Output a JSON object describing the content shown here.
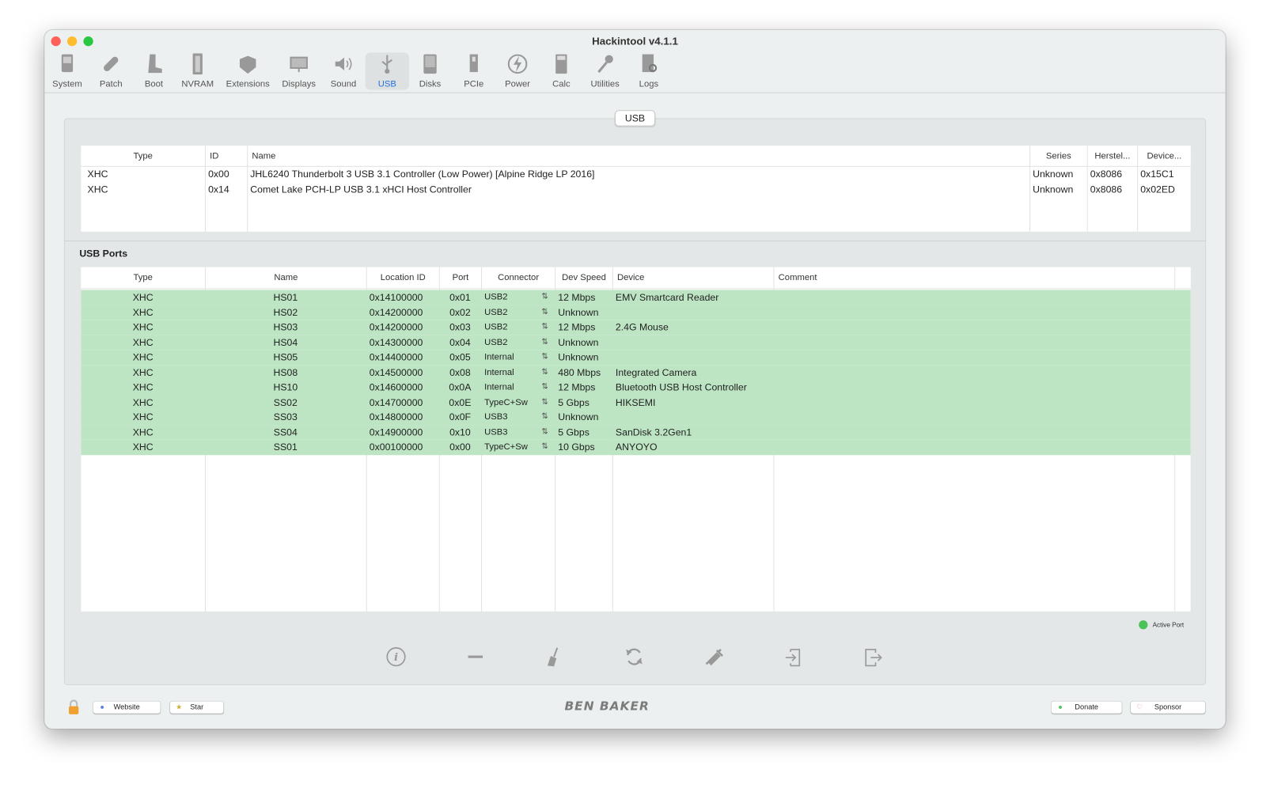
{
  "window": {
    "title": "Hackintool v4.1.1"
  },
  "toolbar": [
    {
      "label": "System",
      "icon": "system-icon"
    },
    {
      "label": "Patch",
      "icon": "patch-icon"
    },
    {
      "label": "Boot",
      "icon": "boot-icon"
    },
    {
      "label": "NVRAM",
      "icon": "nvram-icon"
    },
    {
      "label": "Extensions",
      "icon": "extensions-icon"
    },
    {
      "label": "Displays",
      "icon": "displays-icon"
    },
    {
      "label": "Sound",
      "icon": "sound-icon"
    },
    {
      "label": "USB",
      "icon": "usb-icon",
      "selected": true
    },
    {
      "label": "Disks",
      "icon": "disks-icon"
    },
    {
      "label": "PCIe",
      "icon": "pcie-icon"
    },
    {
      "label": "Power",
      "icon": "power-icon"
    },
    {
      "label": "Calc",
      "icon": "calc-icon"
    },
    {
      "label": "Utilities",
      "icon": "utilities-icon"
    },
    {
      "label": "Logs",
      "icon": "logs-icon"
    }
  ],
  "tab_label": "USB",
  "controllers": {
    "headers": [
      "Type",
      "ID",
      "Name",
      "Series",
      "Herstel...",
      "Device..."
    ],
    "rows": [
      [
        "XHC",
        "0x00",
        "JHL6240 Thunderbolt 3 USB 3.1 Controller (Low Power) [Alpine Ridge LP 2016]",
        "Unknown",
        "0x8086",
        "0x15C1"
      ],
      [
        "XHC",
        "0x14",
        "Comet Lake PCH-LP USB 3.1 xHCI Host Controller",
        "Unknown",
        "0x8086",
        "0x02ED"
      ]
    ]
  },
  "ports_title": "USB Ports",
  "ports": {
    "headers": [
      "Type",
      "Name",
      "Location ID",
      "Port",
      "Connector",
      "Dev Speed",
      "Device",
      "Comment"
    ],
    "rows": [
      [
        "XHC",
        "HS01",
        "0x14100000",
        "0x01",
        "USB2",
        "12 Mbps",
        "EMV Smartcard Reader",
        ""
      ],
      [
        "XHC",
        "HS02",
        "0x14200000",
        "0x02",
        "USB2",
        "Unknown",
        "",
        ""
      ],
      [
        "XHC",
        "HS03",
        "0x14200000",
        "0x03",
        "USB2",
        "12 Mbps",
        "2.4G Mouse",
        ""
      ],
      [
        "XHC",
        "HS04",
        "0x14300000",
        "0x04",
        "USB2",
        "Unknown",
        "",
        ""
      ],
      [
        "XHC",
        "HS05",
        "0x14400000",
        "0x05",
        "Internal",
        "Unknown",
        "",
        ""
      ],
      [
        "XHC",
        "HS08",
        "0x14500000",
        "0x08",
        "Internal",
        "480 Mbps",
        "Integrated Camera",
        ""
      ],
      [
        "XHC",
        "HS10",
        "0x14600000",
        "0x0A",
        "Internal",
        "12 Mbps",
        "Bluetooth USB Host Controller",
        ""
      ],
      [
        "XHC",
        "SS02",
        "0x14700000",
        "0x0E",
        "TypeC+Sw",
        "5 Gbps",
        "HIKSEMI",
        ""
      ],
      [
        "XHC",
        "SS03",
        "0x14800000",
        "0x0F",
        "USB3",
        "Unknown",
        "",
        ""
      ],
      [
        "XHC",
        "SS04",
        "0x14900000",
        "0x10",
        "USB3",
        "5 Gbps",
        " SanDisk 3.2Gen1",
        ""
      ],
      [
        "XHC",
        "SS01",
        "0x00100000",
        "0x00",
        "TypeC+Sw",
        "10 Gbps",
        "ANYOYO",
        ""
      ]
    ],
    "active_color": "#bde5c4"
  },
  "legend": {
    "label": "Active Port",
    "color": "#4cc25a"
  },
  "footer": {
    "website": "Website",
    "star": "Star",
    "logo": "BEN BAKER",
    "donate": "Donate",
    "sponsor": "Sponsor"
  }
}
